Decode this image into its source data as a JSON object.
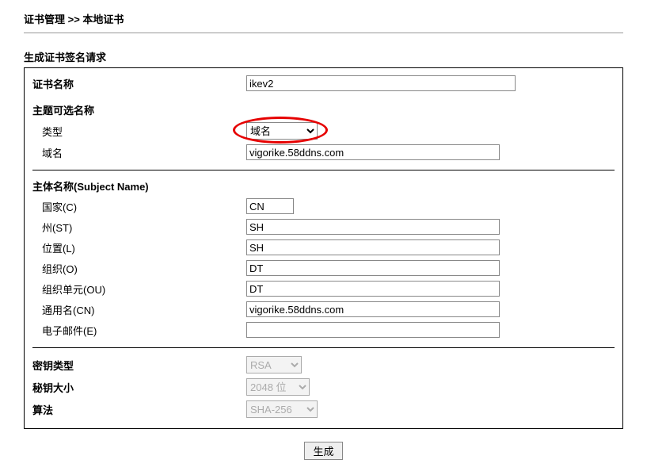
{
  "breadcrumb": "证书管理 >> 本地证书",
  "section_title": "生成证书签名请求",
  "labels": {
    "cert_name": "证书名称",
    "san_header": "主题可选名称",
    "san_type": "类型",
    "san_domain": "域名",
    "subject_header": "主体名称(Subject Name)",
    "country": "国家(C)",
    "state": "州(ST)",
    "location": "位置(L)",
    "org": "组织(O)",
    "org_unit": "组织单元(OU)",
    "common_name": "通用名(CN)",
    "email": "电子邮件(E)",
    "key_type": "密钥类型",
    "key_size": "秘钥大小",
    "algorithm": "算法"
  },
  "values": {
    "cert_name": "ikev2",
    "san_type": "域名",
    "san_domain": "vigorike.58ddns.com",
    "country": "CN",
    "state": "SH",
    "location": "SH",
    "org": "DT",
    "org_unit": "DT",
    "common_name": "vigorike.58ddns.com",
    "email": "",
    "key_type": "RSA",
    "key_size": "2048 位",
    "algorithm": "SHA-256"
  },
  "buttons": {
    "generate": "生成"
  }
}
